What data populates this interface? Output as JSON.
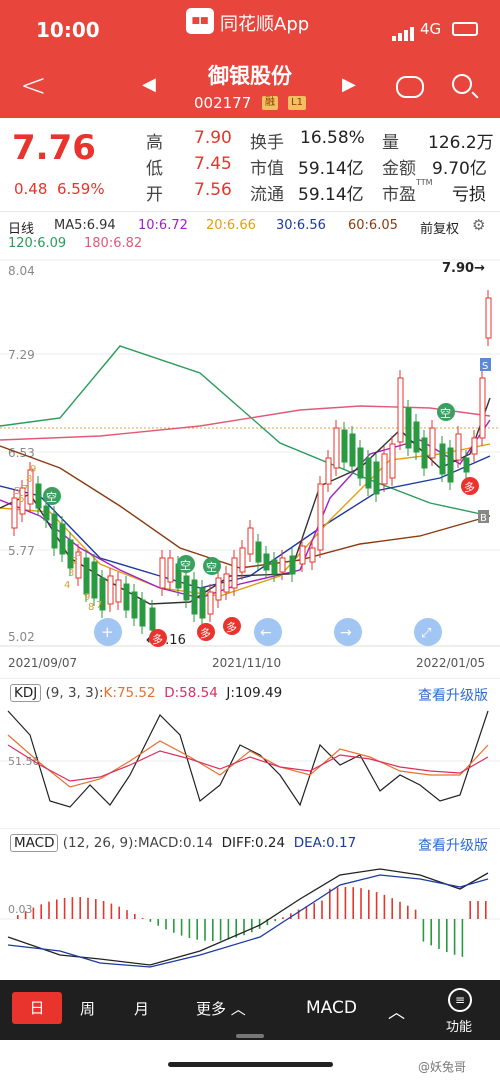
{
  "status": {
    "time": "10:00",
    "app": "同花顺App",
    "network": "4G"
  },
  "nav": {
    "name": "御银股份",
    "code": "002177",
    "tag1": "融",
    "tag2": "L1"
  },
  "quote": {
    "price": "7.76",
    "change": "0.48",
    "change_pct": "6.59%",
    "high_label": "高",
    "high": "7.90",
    "low_label": "低",
    "low": "7.45",
    "open_label": "开",
    "open": "7.56",
    "turnover_label": "换手",
    "turnover": "16.58%",
    "mktcap_label": "市值",
    "mktcap": "59.14亿",
    "float_label": "流通",
    "float": "59.14亿",
    "vol_label": "量",
    "vol": "126.2万",
    "amount_label": "金额",
    "amount": "9.70亿",
    "pe_label": "市盈",
    "pe_sup": "TTM",
    "pe": "亏损"
  },
  "ma": {
    "period": "日线",
    "ma5": "MA5:6.94",
    "ma10": "10:6.72",
    "ma20": "20:6.66",
    "ma30": "30:6.56",
    "ma60": "60:6.05",
    "ma120": "120:6.09",
    "ma180": "180:6.82",
    "adjust": "前复权",
    "colors": {
      "ma5": "#333333",
      "ma10": "#a020c8",
      "ma20": "#e0a010",
      "ma30": "#1a3aa0",
      "ma60": "#8b3a10",
      "ma120": "#2a9a5a",
      "ma180": "#e05a78"
    }
  },
  "kline": {
    "y_labels": [
      "8.04",
      "7.29",
      "6.53",
      "5.77",
      "5.02"
    ],
    "x_labels": [
      "2021/09/07",
      "2021/11/10",
      "2022/01/05"
    ],
    "high_marker": "7.90→",
    "low_marker": "←5.16",
    "badge_kong": "空",
    "badge_duo": "多",
    "badge_s": "S",
    "badge_b": "B",
    "seq_nums": [
      "9",
      "8",
      "7",
      "6",
      "5",
      "4",
      "3",
      "2",
      "1"
    ]
  },
  "kdj": {
    "name": "KDJ",
    "params": "(9, 3, 3):",
    "k": "K:75.52",
    "d": "D:58.54",
    "j": "J:109.49",
    "level": "51.56",
    "upgrade": "查看升级版"
  },
  "macd": {
    "name": "MACD",
    "params": "(12, 26, 9):MACD:0.14",
    "diff": "DIFF:0.24",
    "dea": "DEA:0.17",
    "level": "0.03",
    "upgrade": "查看升级版"
  },
  "bottom": {
    "day": "日",
    "week": "周",
    "month": "月",
    "more": "更多",
    "indicator": "MACD",
    "func": "功能"
  },
  "watermark": "@妖兔哥"
}
